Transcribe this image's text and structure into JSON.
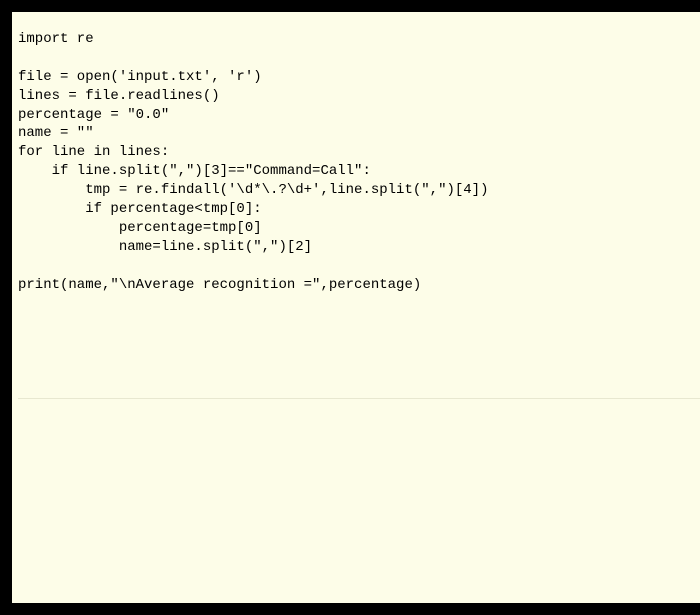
{
  "code": "import re\n\nfile = open('input.txt', 'r')\nlines = file.readlines()\npercentage = \"0.0\"\nname = \"\"\nfor line in lines:\n    if line.split(\",\")[3]==\"Command=Call\":\n        tmp = re.findall('\\d*\\.?\\d+',line.split(\",\")[4])\n        if percentage<tmp[0]:\n            percentage=tmp[0]\n            name=line.split(\",\")[2]\n\nprint(name,\"\\nAverage recognition =\",percentage)"
}
